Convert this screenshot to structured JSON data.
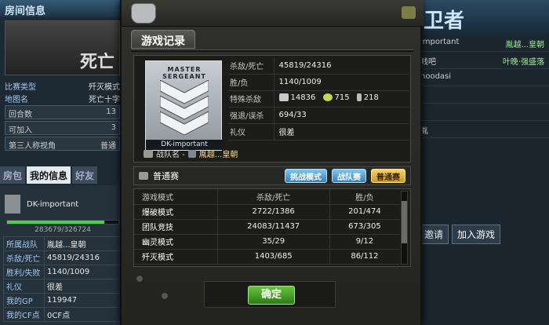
{
  "background": {
    "left_header": "房间信息",
    "room_name": "死亡",
    "room_rows": [
      {
        "k": "比赛类型",
        "v": "歼灭模式"
      },
      {
        "k": "地图名",
        "v": "死亡十字"
      }
    ],
    "selects": [
      {
        "label": "回合数",
        "value": "13"
      },
      {
        "label": "可加入",
        "value": "3"
      },
      {
        "label": "第三人称视角",
        "value": "普通"
      }
    ],
    "tabs": [
      "房包",
      "我的信息",
      "好友"
    ],
    "player_name": "DK-important",
    "exp_text": "283679/326724",
    "exp_fraction": 0.87,
    "info_rows": [
      {
        "k": "所属战队",
        "v": "胤越...皇朝"
      },
      {
        "k": "杀敌/死亡",
        "v": "45819/24316"
      },
      {
        "k": "胜利/失败",
        "v": "1140/1009"
      },
      {
        "k": "礼仪",
        "v": "很差"
      },
      {
        "k": "我的GP",
        "v": "119947"
      },
      {
        "k": "我的CF点",
        "v": "0CF点"
      }
    ],
    "right_logo": "卫者",
    "player_list": [
      {
        "name": "important",
        "clan": "胤越...皇朝"
      },
      {
        "name": "贱吧",
        "clan": "叶晚·强盛落"
      },
      {
        "name": "hoodasi",
        "clan": ""
      },
      {
        "name": "",
        "clan": ""
      },
      {
        "name": "",
        "clan": ""
      },
      {
        "name": "胤",
        "clan": ""
      }
    ],
    "right_buttons": [
      "邀请",
      "加入游戏"
    ]
  },
  "modal": {
    "title": "游戏记录",
    "rank_card": {
      "line1": "MASTER",
      "line2": "SERGEANT",
      "name": "DK-important"
    },
    "stats": {
      "kd_label": "杀敌/死亡",
      "kd_value": "45819/24316",
      "wl_label": "胜/负",
      "wl_value": "1140/1009",
      "special_label": "特殊杀敌",
      "special_values": [
        "14836",
        "715",
        "218"
      ],
      "strong_label": "强退/误杀",
      "strong_value": "694/33",
      "manners_label": "礼仪",
      "manners_value": "很差"
    },
    "clan": {
      "label": "战队名 -",
      "name": "胤越...皇朝"
    },
    "mode_label": "普通赛",
    "mode_buttons": [
      "挑战模式",
      "战队赛",
      "普通赛"
    ],
    "table": {
      "headers": [
        "游戏模式",
        "杀敌/死亡",
        "胜/负"
      ],
      "rows": [
        [
          "爆破模式",
          "2722/1386",
          "201/474"
        ],
        [
          "团队竞技",
          "24083/11437",
          "673/305"
        ],
        [
          "幽灵模式",
          "35/29",
          "9/12"
        ],
        [
          "歼灭模式",
          "1403/685",
          "86/112"
        ]
      ]
    },
    "ok_label": "确定"
  }
}
